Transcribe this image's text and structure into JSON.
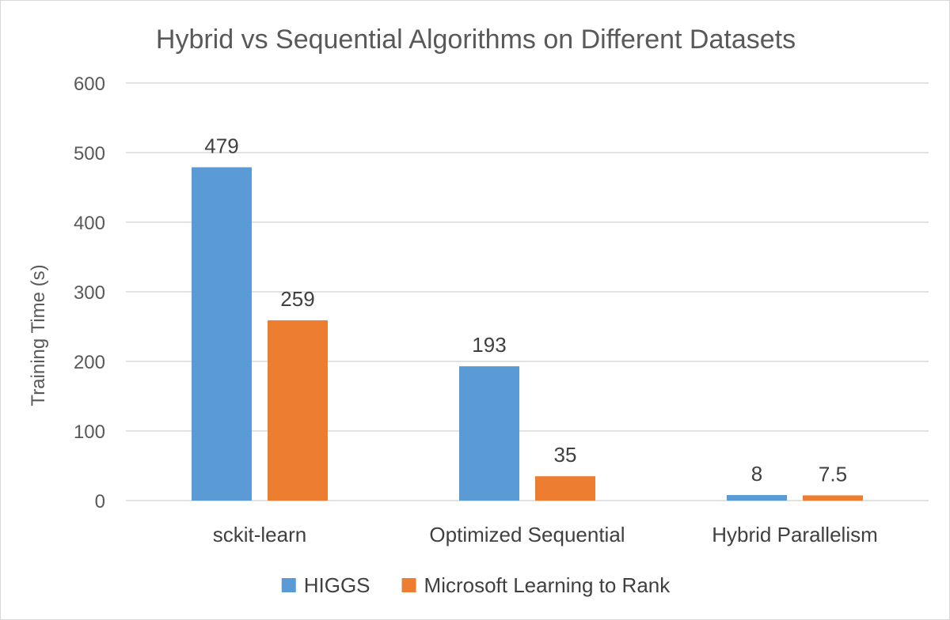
{
  "chart_data": {
    "type": "bar",
    "title": "Hybrid vs Sequential Algorithms on Different Datasets",
    "xlabel": "",
    "ylabel": "Training Time (s)",
    "ylim": [
      0,
      600
    ],
    "yticks": [
      0,
      100,
      200,
      300,
      400,
      500,
      600
    ],
    "grid": true,
    "legend_position": "bottom",
    "categories": [
      "sckit-learn",
      "Optimized Sequential",
      "Hybrid Parallelism"
    ],
    "series": [
      {
        "name": "HIGGS",
        "color": "#5b9bd5",
        "values": [
          479,
          193,
          8
        ],
        "labels": [
          "479",
          "193",
          "8"
        ]
      },
      {
        "name": "Microsoft Learning to Rank",
        "color": "#ed7d31",
        "values": [
          259,
          35,
          7.5
        ],
        "labels": [
          "259",
          "35",
          "7.5"
        ]
      }
    ]
  }
}
